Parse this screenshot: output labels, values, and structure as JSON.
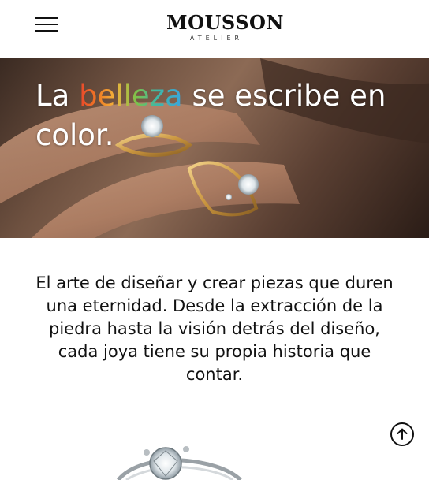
{
  "header": {
    "menu_icon": "hamburger-menu-icon",
    "logo": {
      "name": "MOUSSON",
      "tagline": "ATELIER"
    }
  },
  "hero": {
    "title_before": "La ",
    "title_highlight": "belleza",
    "title_after": " se escribe en color.",
    "image": "hand-wearing-gold-rings"
  },
  "intro": {
    "text": "El arte de diseñar y crear piezas que duren una eternidad. Desde la extracción de la piedra hasta la visión detrás del diseño, cada joya tiene su propia historia que contar."
  },
  "scroll_top_icon": "arrow-up-circle-icon",
  "product_preview": {
    "image": "diamond-ring"
  },
  "colors": {
    "background": "#ffffff",
    "text": "#111111",
    "hero_text": "#ffffff",
    "highlight_gradient": [
      "#e8452c",
      "#f07a24",
      "#f3b43b",
      "#7cc24a",
      "#3fb7a6",
      "#39a4e0"
    ]
  }
}
